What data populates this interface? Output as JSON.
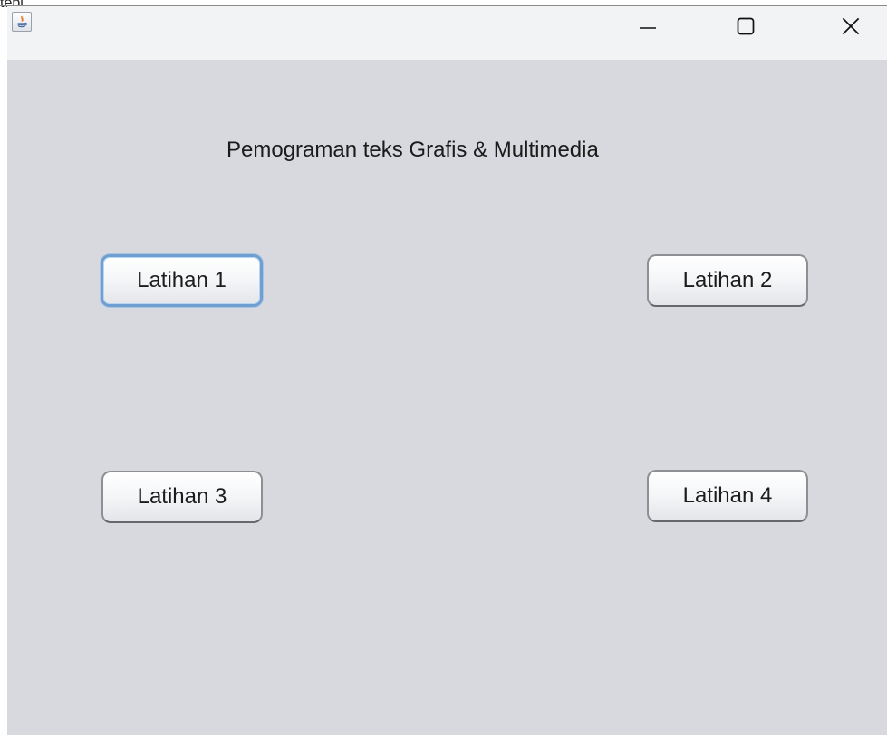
{
  "top_fragment": "tepi ... ... ... ...",
  "window": {
    "controls": {
      "minimize_icon": "minimize-icon",
      "maximize_icon": "maximize-icon",
      "close_icon": "close-icon"
    },
    "heading": "Pemograman teks Grafis & Multimedia",
    "buttons": [
      {
        "label": "Latihan 1",
        "focused": true
      },
      {
        "label": "Latihan 2",
        "focused": false
      },
      {
        "label": "Latihan 3",
        "focused": false
      },
      {
        "label": "Latihan 4",
        "focused": false
      }
    ]
  },
  "colors": {
    "window_background": "#d7d9df",
    "titlebar_background": "#f2f3f5",
    "button_focus_border": "#6f9fd0"
  }
}
